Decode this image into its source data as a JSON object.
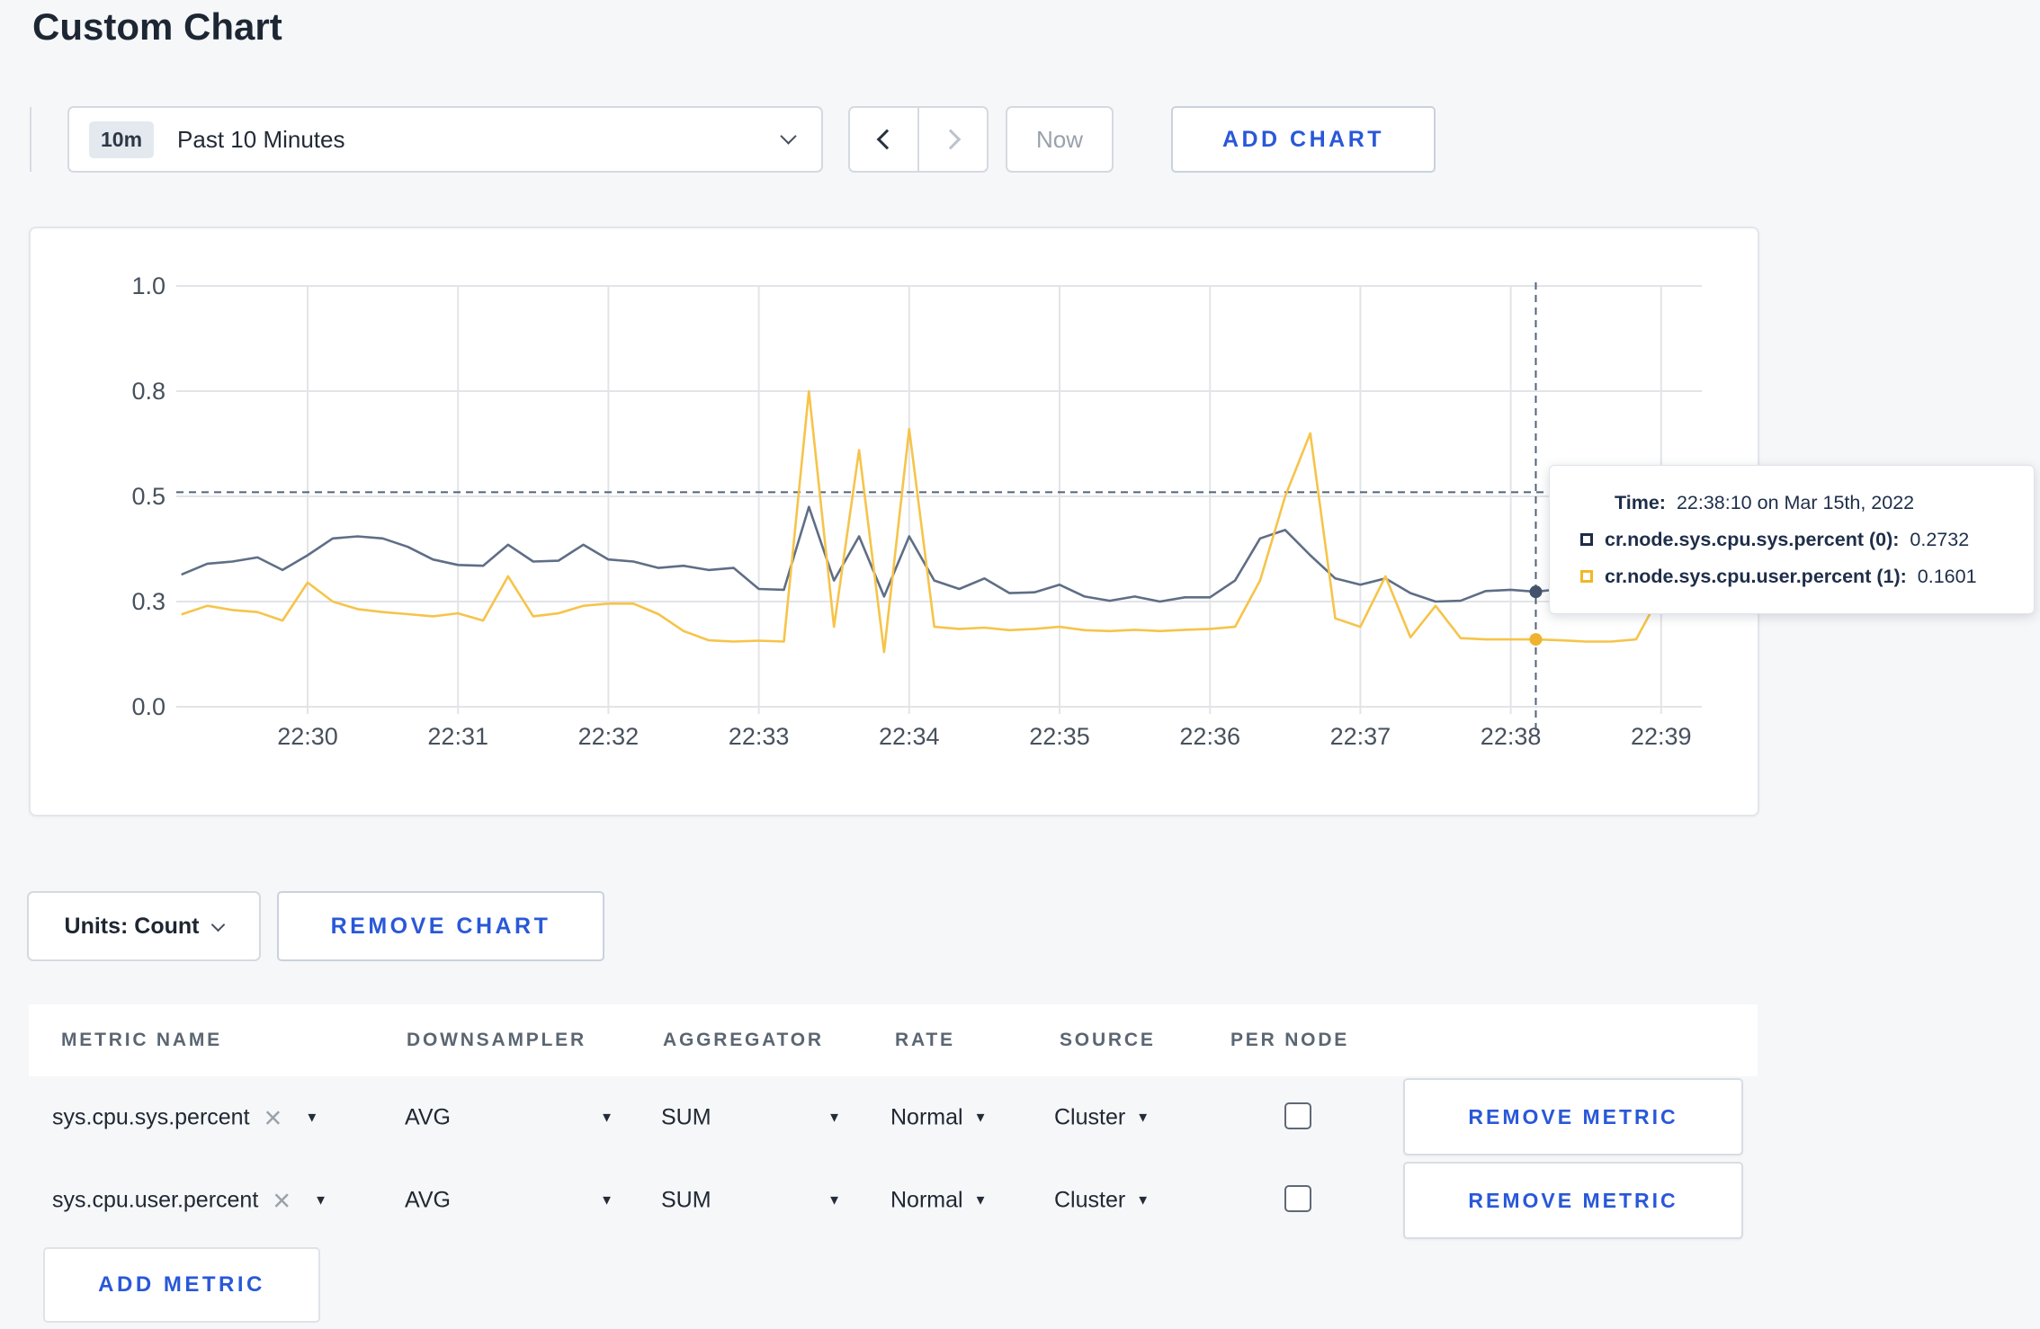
{
  "page": {
    "title": "Custom Chart"
  },
  "colors": {
    "accent_blue": "#2958d8",
    "page_background": "#f6f7f9",
    "grid": "#e3e4e8",
    "axis_text": "#47515d",
    "crosshair_dashed": "#51647c",
    "series_sys": "#5f6e86",
    "series_user": "#f6c44a",
    "legend_sys_square": "#1d2c48",
    "legend_user_square": "#f2b728"
  },
  "toolbar": {
    "time_window_badge": "10m",
    "time_window_label": "Past 10 Minutes",
    "dropdown_icon": "chevron-down",
    "prev_icon": "chevron-left",
    "next_icon": "chevron-right",
    "now_label": "Now",
    "add_chart_label": "ADD CHART"
  },
  "chart_controls": {
    "units_label": "Units: Count",
    "units_icon": "chevron-down",
    "remove_chart_label": "REMOVE CHART"
  },
  "tooltip": {
    "time_label": "Time:",
    "time_value": "22:38:10 on Mar 15th, 2022",
    "series": [
      {
        "label": "cr.node.sys.cpu.sys.percent (0):",
        "value": "0.2732",
        "swatch": "navy-outline-square"
      },
      {
        "label": "cr.node.sys.cpu.user.percent (1):",
        "value": "0.1601",
        "swatch": "yellow-outline-square"
      }
    ]
  },
  "metrics_table": {
    "headers": [
      "METRIC NAME",
      "DOWNSAMPLER",
      "AGGREGATOR",
      "RATE",
      "SOURCE",
      "PER NODE"
    ],
    "rows": [
      {
        "metric": "sys.cpu.sys.percent",
        "downsampler": "AVG",
        "aggregator": "SUM",
        "rate": "Normal",
        "source": "Cluster",
        "per_node_checked": false,
        "remove_label": "REMOVE METRIC"
      },
      {
        "metric": "sys.cpu.user.percent",
        "downsampler": "AVG",
        "aggregator": "SUM",
        "rate": "Normal",
        "source": "Cluster",
        "per_node_checked": false,
        "remove_label": "REMOVE METRIC"
      }
    ],
    "clear_icon": "x-clear",
    "select_icon": "triangle-down",
    "add_metric_label": "ADD METRIC"
  },
  "chart_data": {
    "type": "line",
    "title": "",
    "xlabel": "",
    "ylabel": "",
    "ylim": [
      0,
      1
    ],
    "grid": true,
    "x_start_time": "22:29:10",
    "x_interval_seconds": 10,
    "x_ticks": [
      "22:30",
      "22:31",
      "22:32",
      "22:33",
      "22:34",
      "22:35",
      "22:36",
      "22:37",
      "22:38",
      "22:39"
    ],
    "y_ticks": [
      {
        "label": "0.0",
        "value": 0
      },
      {
        "label": "0.3",
        "value": 0.25
      },
      {
        "label": "0.5",
        "value": 0.5
      },
      {
        "label": "0.8",
        "value": 0.75
      },
      {
        "label": "1.0",
        "value": 1.0
      }
    ],
    "crosshair": {
      "time": "22:38:10",
      "offset_seconds_from_2230": 490,
      "hline_value": 0.51,
      "sys_value": 0.2732,
      "user_value": 0.1601
    },
    "series": [
      {
        "name": "cr.node.sys.cpu.sys.percent",
        "color": "#5f6e86",
        "values": [
          0.315,
          0.34,
          0.345,
          0.355,
          0.325,
          0.36,
          0.4,
          0.405,
          0.4,
          0.38,
          0.35,
          0.337,
          0.335,
          0.385,
          0.345,
          0.347,
          0.385,
          0.35,
          0.345,
          0.33,
          0.335,
          0.325,
          0.33,
          0.28,
          0.278,
          0.475,
          0.3,
          0.405,
          0.262,
          0.405,
          0.3,
          0.28,
          0.305,
          0.27,
          0.272,
          0.29,
          0.262,
          0.252,
          0.262,
          0.25,
          0.26,
          0.26,
          0.3,
          0.4,
          0.42,
          0.36,
          0.305,
          0.29,
          0.305,
          0.27,
          0.25,
          0.252,
          0.275,
          0.278,
          0.2732,
          0.28,
          0.262,
          0.27,
          0.29,
          0.29,
          0.3
        ]
      },
      {
        "name": "cr.node.sys.cpu.user.percent",
        "color": "#f6c44a",
        "values": [
          0.22,
          0.24,
          0.23,
          0.225,
          0.205,
          0.295,
          0.25,
          0.232,
          0.225,
          0.22,
          0.215,
          0.222,
          0.205,
          0.31,
          0.215,
          0.222,
          0.24,
          0.245,
          0.245,
          0.22,
          0.18,
          0.158,
          0.155,
          0.157,
          0.155,
          0.75,
          0.19,
          0.61,
          0.13,
          0.66,
          0.19,
          0.185,
          0.188,
          0.182,
          0.185,
          0.19,
          0.182,
          0.18,
          0.183,
          0.18,
          0.183,
          0.185,
          0.19,
          0.3,
          0.5,
          0.65,
          0.21,
          0.19,
          0.31,
          0.165,
          0.24,
          0.163,
          0.16,
          0.16,
          0.1601,
          0.158,
          0.155,
          0.155,
          0.16,
          0.27,
          0.235
        ]
      }
    ]
  }
}
